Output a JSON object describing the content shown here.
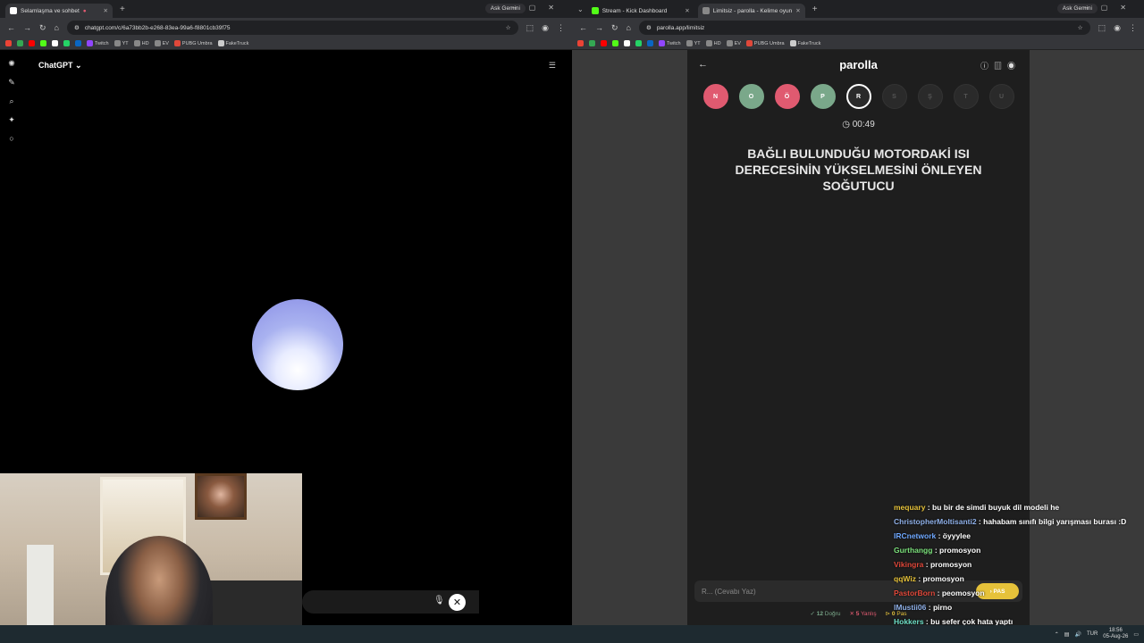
{
  "left_browser": {
    "tab": {
      "title": "Selamlaşma ve sohbet"
    },
    "gemini": "Ask Gemini",
    "url": "chatgpt.com/c/6a73bb2b-e268-83ea-99a6-f8801cb39f75",
    "bookmarks": [
      "Twitch",
      "YT",
      "HD",
      "EV",
      "PUBG Umbra",
      "FakeTruck"
    ]
  },
  "right_browser": {
    "tabs": [
      {
        "title": "Stream - Kick Dashboard"
      },
      {
        "title": "Limitsiz - parolla - Kelime oyun"
      }
    ],
    "gemini": "Ask Gemini",
    "url": "parolla.app/limitsiz",
    "bookmarks": [
      "Twitch",
      "YT",
      "HD",
      "EV",
      "PUBG Umbra",
      "FakeTruck"
    ]
  },
  "chatgpt": {
    "title": "ChatGPT"
  },
  "parolla": {
    "title": "parolla",
    "letters": [
      {
        "l": "N",
        "state": "wrong"
      },
      {
        "l": "O",
        "state": "correct"
      },
      {
        "l": "Ö",
        "state": "wrong"
      },
      {
        "l": "P",
        "state": "correct"
      },
      {
        "l": "R",
        "state": "active"
      },
      {
        "l": "S",
        "state": "pending"
      },
      {
        "l": "Ş",
        "state": "pending"
      },
      {
        "l": "T",
        "state": "pending"
      },
      {
        "l": "U",
        "state": "pending"
      }
    ],
    "timer": "00:49",
    "question": "BAĞLI BULUNDUĞU MOTORDAKİ ISI DERECESİNİN YÜKSELMESİNİ ÖNLEYEN SOĞUTUCU",
    "answer_placeholder": "R... (Cevabı Yaz)",
    "pas_label": "PAS",
    "stats": {
      "correct": "12",
      "correct_label": "Doğru",
      "wrong": "5",
      "wrong_label": "Yanlış",
      "pas": "0",
      "pas_label": "Pas"
    }
  },
  "chat": [
    {
      "user": "mequary",
      "color": "#e6c23a",
      "text": "bu bir de simdi buyuk dil modeli he"
    },
    {
      "user": "ChristopherMoltisanti2",
      "color": "#8fb0e8",
      "text": "hahabam sınıfı bilgi yarışması burası :D"
    },
    {
      "user": "IRCnetwork",
      "color": "#6fa8ff",
      "text": "öyyylee"
    },
    {
      "user": "Gurthangg",
      "color": "#7be07b",
      "text": "promosyon"
    },
    {
      "user": "Vikingra",
      "color": "#e0483a",
      "text": "promosyon"
    },
    {
      "user": "qqWiz",
      "color": "#e6c23a",
      "text": "promosyon"
    },
    {
      "user": "PastorBorn",
      "color": "#e0483a",
      "text": "peomosyon"
    },
    {
      "user": "lMustii06",
      "color": "#8fb0e8",
      "text": "pirno"
    },
    {
      "user": "Hokkers",
      "color": "#6ee0c8",
      "text": "bu sefer çok hata yaptı"
    }
  ],
  "taskbar": {
    "lang": "TUR",
    "time": "18:56",
    "date": "05-Aug-26"
  }
}
